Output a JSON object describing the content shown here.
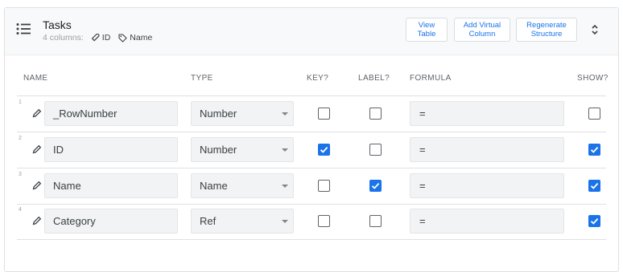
{
  "table": {
    "title": "Tasks",
    "column_count_text": "4 columns:",
    "key_column": "ID",
    "label_column": "Name"
  },
  "actions": {
    "view_table": [
      "View",
      "Table"
    ],
    "add_virtual_column": [
      "Add Virtual",
      "Column"
    ],
    "regenerate_structure": [
      "Regenerate",
      "Structure"
    ]
  },
  "headers": {
    "name": "NAME",
    "type": "TYPE",
    "key": "KEY?",
    "label": "LABEL?",
    "formula": "FORMULA",
    "show": "SHOW?"
  },
  "rows": [
    {
      "num": "1",
      "name": "_RowNumber",
      "type": "Number",
      "key": false,
      "label": false,
      "formula": "=",
      "show": false
    },
    {
      "num": "2",
      "name": "ID",
      "type": "Number",
      "key": true,
      "label": false,
      "formula": "=",
      "show": true
    },
    {
      "num": "3",
      "name": "Name",
      "type": "Name",
      "key": false,
      "label": true,
      "formula": "=",
      "show": true
    },
    {
      "num": "4",
      "name": "Category",
      "type": "Ref",
      "key": false,
      "label": false,
      "formula": "=",
      "show": true
    }
  ],
  "icons": {
    "table": "list-icon",
    "key": "key-icon",
    "label": "tag-icon",
    "edit": "pencil-icon",
    "expand": "unfold-icon",
    "dropdown": "caret-down-icon",
    "checked": "checkmark-icon"
  },
  "colors": {
    "accent": "#1a73e8",
    "header_bg": "#f8f9fa",
    "field_bg": "#f1f3f4"
  }
}
